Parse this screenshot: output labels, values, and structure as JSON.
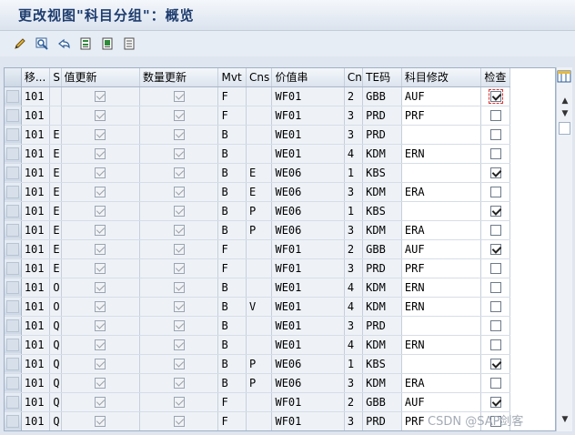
{
  "window": {
    "title": "更改视图\"科目分组\"：概览"
  },
  "toolbar": {
    "buttons": [
      {
        "name": "edit-pencil-icon"
      },
      {
        "name": "display-change-icon"
      },
      {
        "name": "undo-icon"
      },
      {
        "name": "copy-as-icon"
      },
      {
        "name": "delete-icon"
      },
      {
        "name": "select-all-icon"
      }
    ]
  },
  "table": {
    "columns": [
      "移...",
      "S",
      "值更新",
      "数量更新",
      "Mvt",
      "Cns",
      "价值串",
      "Cn",
      "TE码",
      "科目修改",
      "检查"
    ],
    "rows": [
      {
        "mv": "101",
        "s": "",
        "val": true,
        "qty": true,
        "mvt": "F",
        "cns": "",
        "vs": "WF01",
        "cn": "2",
        "te": "GBB",
        "acc": "AUF",
        "chk": true
      },
      {
        "mv": "101",
        "s": "",
        "val": true,
        "qty": true,
        "mvt": "F",
        "cns": "",
        "vs": "WF01",
        "cn": "3",
        "te": "PRD",
        "acc": "PRF",
        "chk": false
      },
      {
        "mv": "101",
        "s": "E",
        "val": true,
        "qty": true,
        "mvt": "B",
        "cns": "",
        "vs": "WE01",
        "cn": "3",
        "te": "PRD",
        "acc": "",
        "chk": false
      },
      {
        "mv": "101",
        "s": "E",
        "val": true,
        "qty": true,
        "mvt": "B",
        "cns": "",
        "vs": "WE01",
        "cn": "4",
        "te": "KDM",
        "acc": "ERN",
        "chk": false
      },
      {
        "mv": "101",
        "s": "E",
        "val": true,
        "qty": true,
        "mvt": "B",
        "cns": "E",
        "vs": "WE06",
        "cn": "1",
        "te": "KBS",
        "acc": "",
        "chk": true
      },
      {
        "mv": "101",
        "s": "E",
        "val": true,
        "qty": true,
        "mvt": "B",
        "cns": "E",
        "vs": "WE06",
        "cn": "3",
        "te": "KDM",
        "acc": "ERA",
        "chk": false
      },
      {
        "mv": "101",
        "s": "E",
        "val": true,
        "qty": true,
        "mvt": "B",
        "cns": "P",
        "vs": "WE06",
        "cn": "1",
        "te": "KBS",
        "acc": "",
        "chk": true
      },
      {
        "mv": "101",
        "s": "E",
        "val": true,
        "qty": true,
        "mvt": "B",
        "cns": "P",
        "vs": "WE06",
        "cn": "3",
        "te": "KDM",
        "acc": "ERA",
        "chk": false
      },
      {
        "mv": "101",
        "s": "E",
        "val": true,
        "qty": true,
        "mvt": "F",
        "cns": "",
        "vs": "WF01",
        "cn": "2",
        "te": "GBB",
        "acc": "AUF",
        "chk": true
      },
      {
        "mv": "101",
        "s": "E",
        "val": true,
        "qty": true,
        "mvt": "F",
        "cns": "",
        "vs": "WF01",
        "cn": "3",
        "te": "PRD",
        "acc": "PRF",
        "chk": false
      },
      {
        "mv": "101",
        "s": "O",
        "val": true,
        "qty": true,
        "mvt": "B",
        "cns": "",
        "vs": "WE01",
        "cn": "4",
        "te": "KDM",
        "acc": "ERN",
        "chk": false
      },
      {
        "mv": "101",
        "s": "O",
        "val": true,
        "qty": true,
        "mvt": "B",
        "cns": "V",
        "vs": "WE01",
        "cn": "4",
        "te": "KDM",
        "acc": "ERN",
        "chk": false
      },
      {
        "mv": "101",
        "s": "Q",
        "val": true,
        "qty": true,
        "mvt": "B",
        "cns": "",
        "vs": "WE01",
        "cn": "3",
        "te": "PRD",
        "acc": "",
        "chk": false
      },
      {
        "mv": "101",
        "s": "Q",
        "val": true,
        "qty": true,
        "mvt": "B",
        "cns": "",
        "vs": "WE01",
        "cn": "4",
        "te": "KDM",
        "acc": "ERN",
        "chk": false
      },
      {
        "mv": "101",
        "s": "Q",
        "val": true,
        "qty": true,
        "mvt": "B",
        "cns": "P",
        "vs": "WE06",
        "cn": "1",
        "te": "KBS",
        "acc": "",
        "chk": true
      },
      {
        "mv": "101",
        "s": "Q",
        "val": true,
        "qty": true,
        "mvt": "B",
        "cns": "P",
        "vs": "WE06",
        "cn": "3",
        "te": "KDM",
        "acc": "ERA",
        "chk": false
      },
      {
        "mv": "101",
        "s": "Q",
        "val": true,
        "qty": true,
        "mvt": "F",
        "cns": "",
        "vs": "WF01",
        "cn": "2",
        "te": "GBB",
        "acc": "AUF",
        "chk": true
      },
      {
        "mv": "101",
        "s": "Q",
        "val": true,
        "qty": true,
        "mvt": "F",
        "cns": "",
        "vs": "WF01",
        "cn": "3",
        "te": "PRD",
        "acc": "PRF",
        "chk": false
      }
    ]
  },
  "watermark": "CSDN @SAP剑客"
}
